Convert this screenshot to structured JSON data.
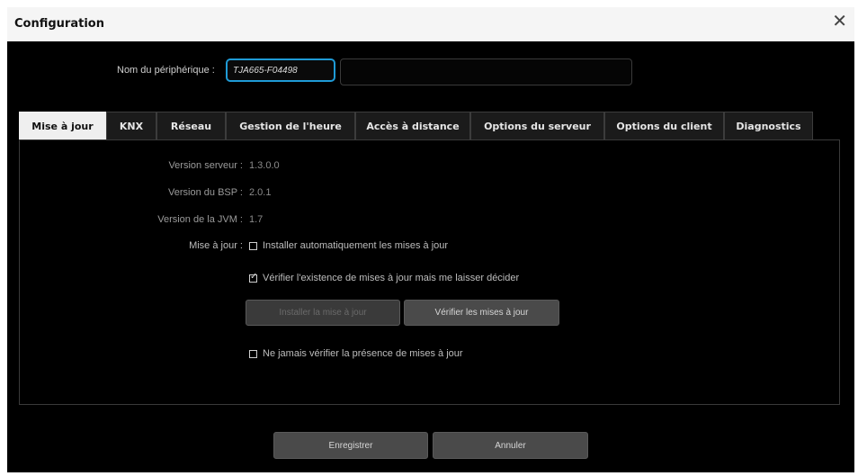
{
  "window": {
    "title": "Configuration",
    "close_glyph": "✕"
  },
  "device": {
    "label": "Nom du périphérique :",
    "value": "TJA665-F04498"
  },
  "tabs": [
    {
      "label": "Mise à jour",
      "active": true
    },
    {
      "label": "KNX",
      "active": false
    },
    {
      "label": "Réseau",
      "active": false
    },
    {
      "label": "Gestion de l'heure",
      "active": false
    },
    {
      "label": "Accès à distance",
      "active": false
    },
    {
      "label": "Options du serveur",
      "active": false
    },
    {
      "label": "Options du client",
      "active": false
    },
    {
      "label": "Diagnostics",
      "active": false
    }
  ],
  "update": {
    "server_version_label": "Version serveur :",
    "server_version": "1.3.0.0",
    "bsp_version_label": "Version du BSP :",
    "bsp_version": "2.0.1",
    "jvm_version_label": "Version de la JVM :",
    "jvm_version": "1.7",
    "update_label": "Mise à jour :",
    "option_auto": {
      "label": "Installer automatiquement les mises à jour",
      "checked": false
    },
    "option_check": {
      "label": "Vérifier l'existence de mises à jour mais me laisser décider",
      "checked": true
    },
    "install_button": "Installer la mise à jour",
    "check_button": "Vérifier les mises à jour",
    "option_never": {
      "label": "Ne jamais vérifier la présence de mises à jour",
      "checked": false
    }
  },
  "footer": {
    "save": "Enregistrer",
    "cancel": "Annuler"
  },
  "colors": {
    "accent": "#1f9bd6",
    "background": "#000000",
    "active_tab": "#efefef"
  }
}
